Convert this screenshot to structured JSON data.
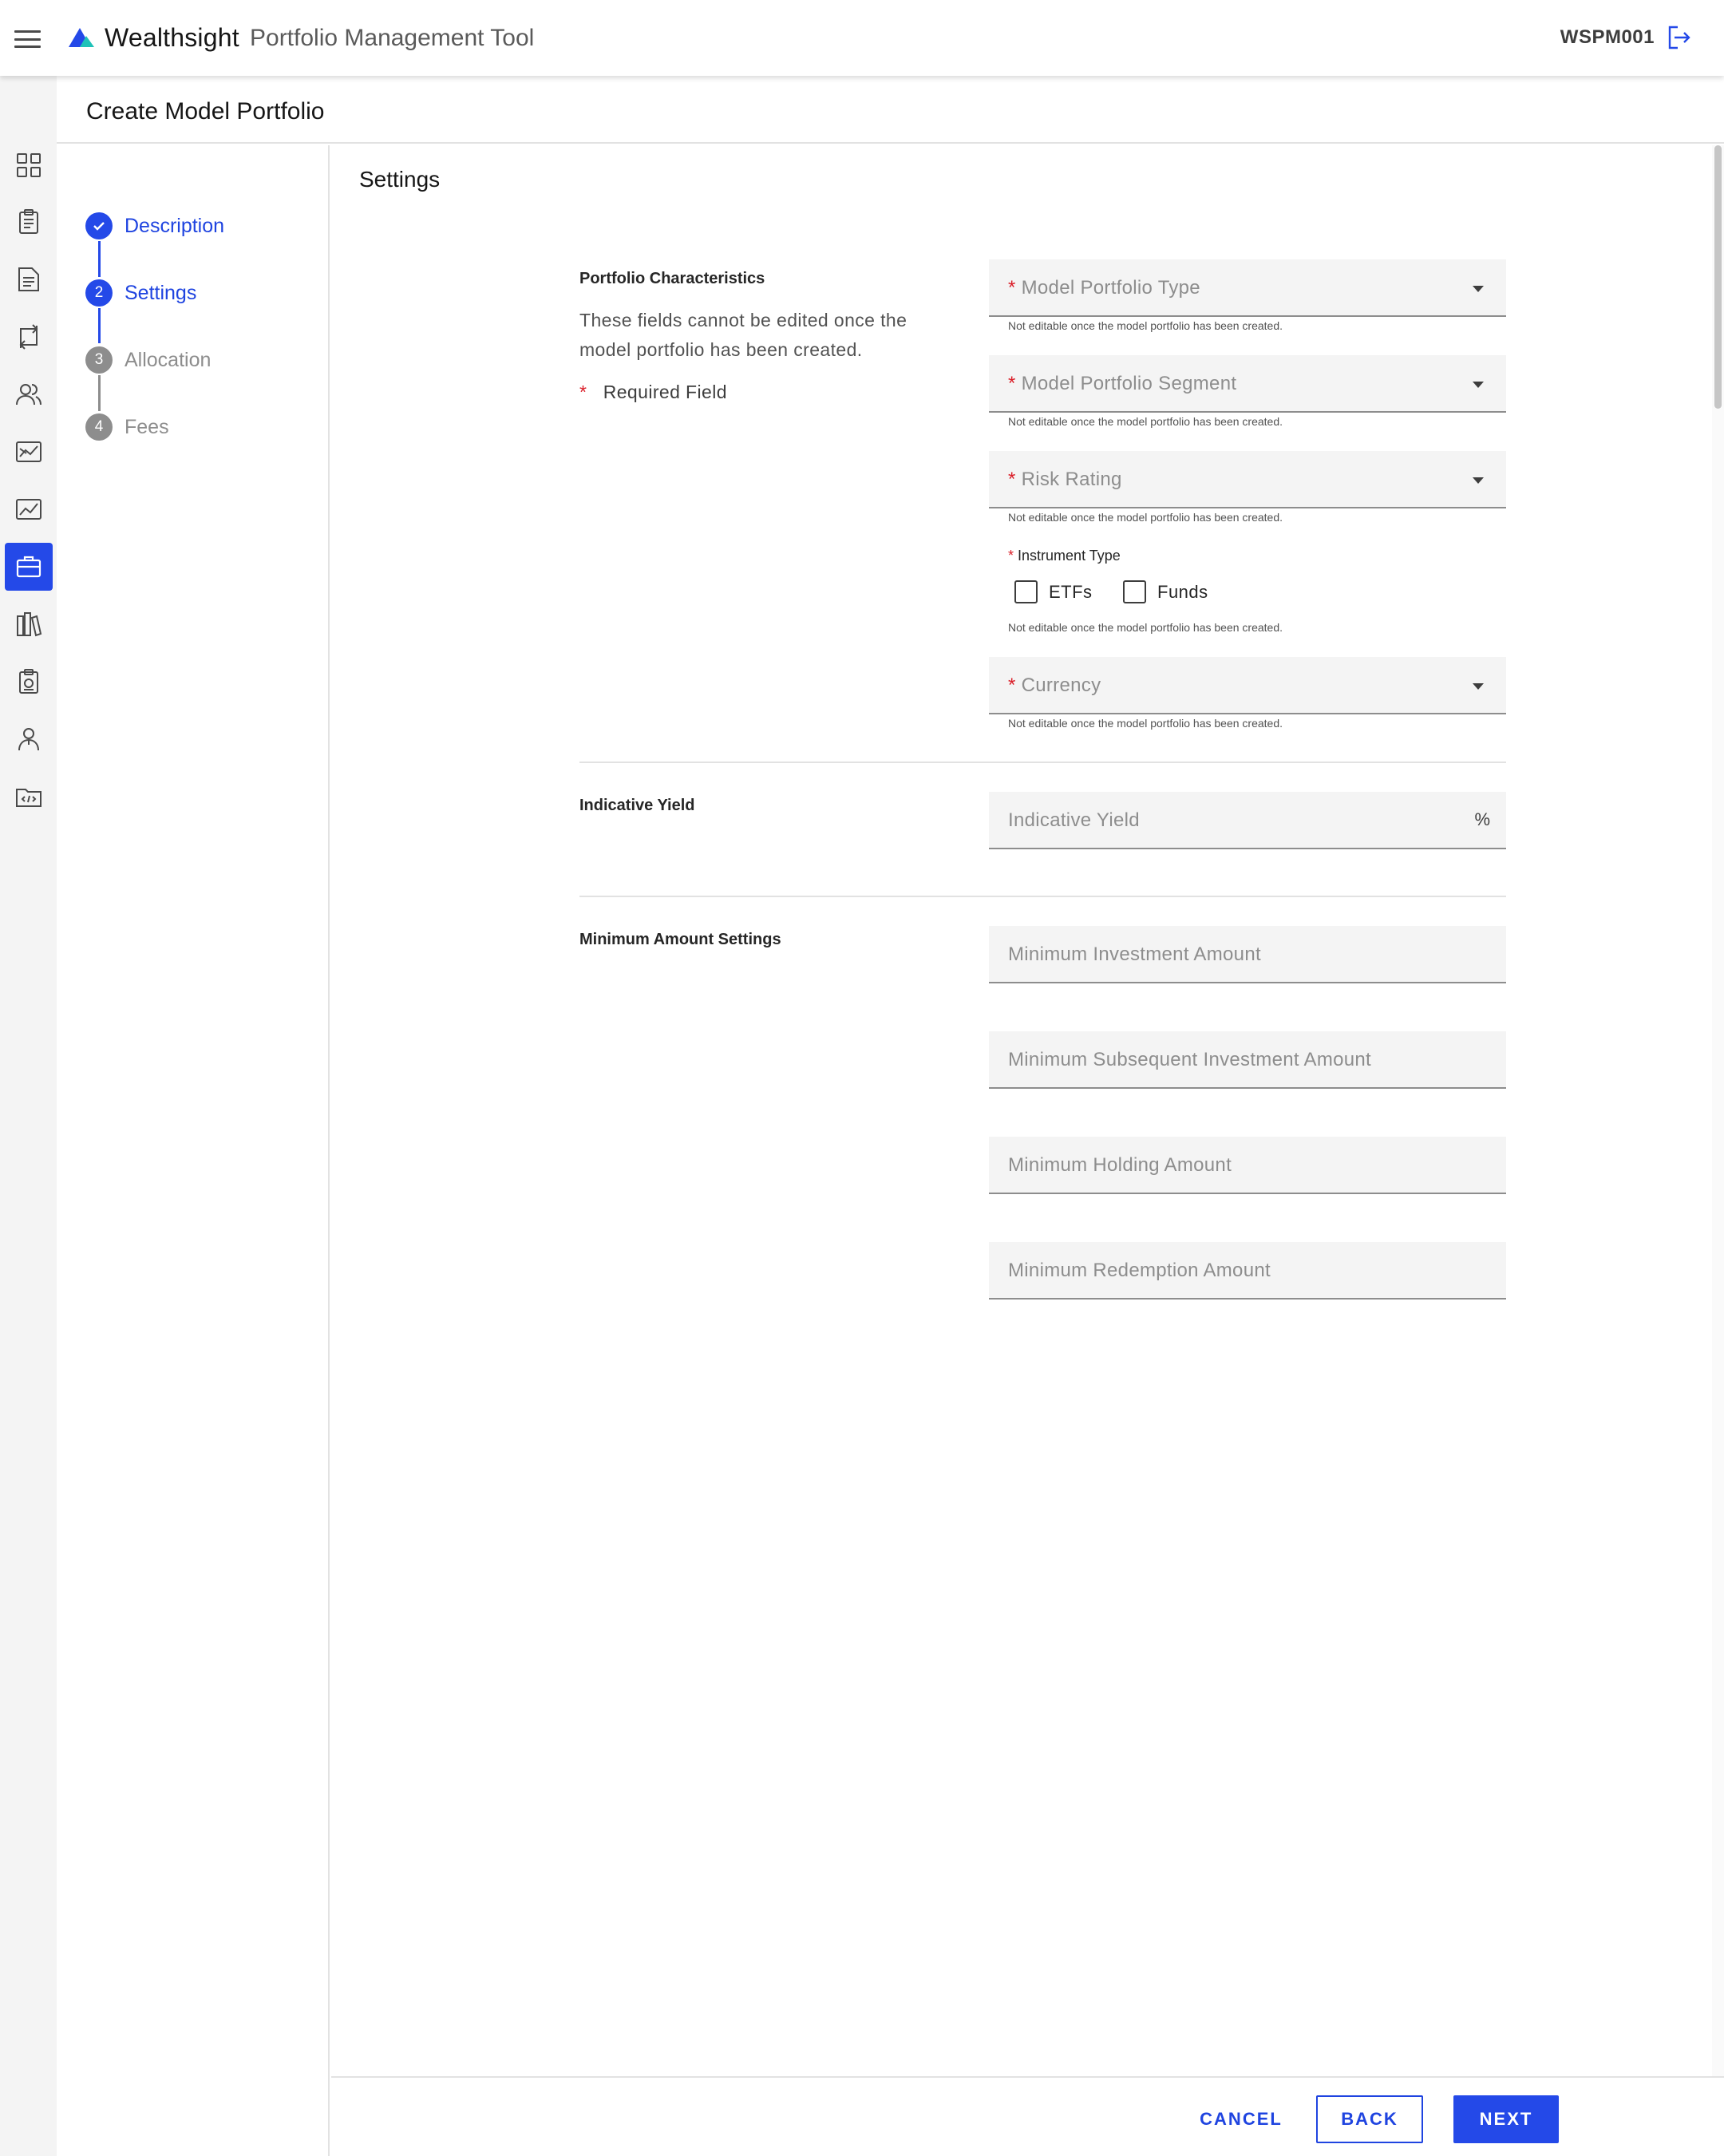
{
  "header": {
    "brand_name": "Wealthsight",
    "brand_tool": "Portfolio Management Tool",
    "user_code": "WSPM001",
    "accent_color": "#2449e8"
  },
  "rail": {
    "items": [
      {
        "icon": "dashboard-grid-icon",
        "active": false
      },
      {
        "icon": "clipboard-report-icon",
        "active": false
      },
      {
        "icon": "document-list-icon",
        "active": false
      },
      {
        "icon": "transfer-arrows-icon",
        "active": false
      },
      {
        "icon": "users-icon",
        "active": false
      },
      {
        "icon": "market-chart-icon",
        "active": false
      },
      {
        "icon": "performance-chart-icon",
        "active": false
      },
      {
        "icon": "briefcase-icon",
        "active": true
      },
      {
        "icon": "library-icon",
        "active": false
      },
      {
        "icon": "clipboard-gear-icon",
        "active": false
      },
      {
        "icon": "user-profile-icon",
        "active": false
      },
      {
        "icon": "folder-code-icon",
        "active": false
      }
    ]
  },
  "page": {
    "title": "Create Model Portfolio"
  },
  "stepper": {
    "steps": [
      {
        "number": "1",
        "label": "Description",
        "state": "done"
      },
      {
        "number": "2",
        "label": "Settings",
        "state": "current"
      },
      {
        "number": "3",
        "label": "Allocation",
        "state": "pending"
      },
      {
        "number": "4",
        "label": "Fees",
        "state": "pending"
      }
    ]
  },
  "settings": {
    "section_title": "Settings",
    "characteristics": {
      "label": "Portfolio Characteristics",
      "note": "These fields cannot be edited once the model portfolio has been created.",
      "required_star": "*",
      "required_label": "Required Field",
      "helper": "Not editable once the model portfolio has been created.",
      "model_portfolio_type": "Model Portfolio Type",
      "model_portfolio_segment": "Model Portfolio Segment",
      "risk_rating": "Risk Rating",
      "instrument_type": "Instrument Type",
      "etfs": "ETFs",
      "funds": "Funds",
      "currency": "Currency"
    },
    "yield": {
      "label": "Indicative Yield",
      "placeholder": "Indicative Yield",
      "suffix": "%"
    },
    "minimums": {
      "label": "Minimum Amount Settings",
      "investment": "Minimum Investment Amount",
      "subsequent": "Minimum Subsequent Investment Amount",
      "holding": "Minimum Holding Amount",
      "redemption": "Minimum Redemption Amount"
    }
  },
  "footer": {
    "cancel": "CANCEL",
    "back": "BACK",
    "next": "NEXT"
  }
}
